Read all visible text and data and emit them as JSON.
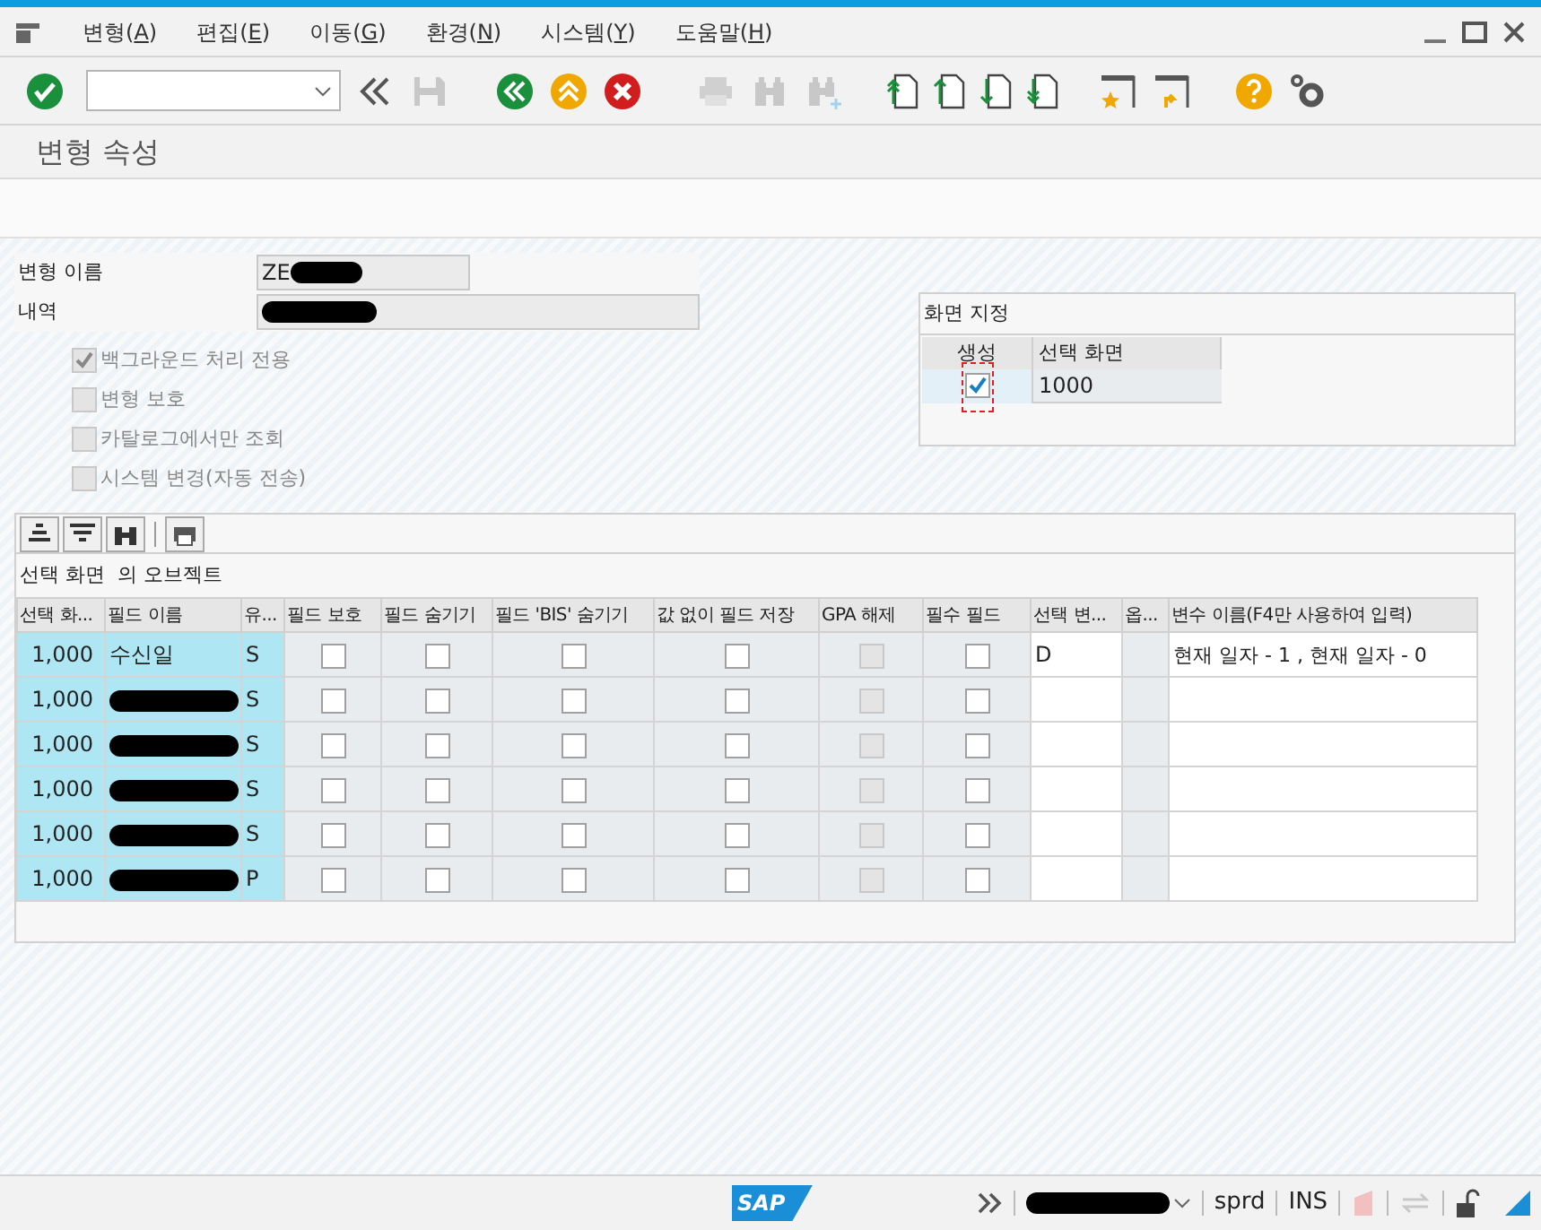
{
  "menu": [
    {
      "before": "변형(",
      "key": "A",
      "after": ")"
    },
    {
      "before": "편집(",
      "key": "E",
      "after": ")"
    },
    {
      "before": "이동(",
      "key": "G",
      "after": ")"
    },
    {
      "before": "환경(",
      "key": "N",
      "after": ")"
    },
    {
      "before": "시스템(",
      "key": "Y",
      "after": ")"
    },
    {
      "before": "도움말(",
      "key": "H",
      "after": ")"
    }
  ],
  "title": "변형 속성",
  "form": {
    "fields": [
      {
        "label": "변형 이름",
        "value": "ZE",
        "redacted": true
      },
      {
        "label": "내역",
        "redacted": true
      }
    ],
    "checkboxes": [
      {
        "label": "백그라운드 처리 전용",
        "checked": true,
        "disabled": true
      },
      {
        "label": "변형 보호",
        "checked": false,
        "disabled": true
      },
      {
        "label": "카탈로그에서만 조회",
        "checked": false,
        "disabled": true
      },
      {
        "label": "시스템 변경(자동 전송)",
        "checked": false,
        "disabled": true
      }
    ]
  },
  "screen_assignment": {
    "title": "화면 지정",
    "columns": [
      "생성",
      "선택 화면"
    ],
    "rows": [
      {
        "created": true,
        "screen": "1000"
      }
    ]
  },
  "grid": {
    "title": "선택 화면  의 오브젝트",
    "columns": [
      {
        "label": "선택 화...",
        "kind": "key"
      },
      {
        "label": "필드 이름",
        "kind": "key"
      },
      {
        "label": "유...",
        "kind": "key"
      },
      {
        "label": "필드 보호",
        "kind": "check"
      },
      {
        "label": "필드 숨기기",
        "kind": "check"
      },
      {
        "label": "필드 'BIS' 숨기기",
        "kind": "check"
      },
      {
        "label": "값 없이 필드 저장",
        "kind": "check"
      },
      {
        "label": "GPA 해제",
        "kind": "locked"
      },
      {
        "label": "필수 필드",
        "kind": "check"
      },
      {
        "label": "선택 변...",
        "kind": "text"
      },
      {
        "label": "옵...",
        "kind": "narrow"
      },
      {
        "label": "변수 이름(F4만 사용하여 입력)",
        "kind": "text"
      }
    ],
    "rows": [
      {
        "cells": [
          {
            "text": "1,000"
          },
          {
            "text": "수신일"
          },
          {
            "text": "S"
          },
          {
            "checked": false
          },
          {
            "checked": false
          },
          {
            "checked": false
          },
          {
            "checked": false
          },
          {
            "checked": false
          },
          {
            "checked": false
          },
          {
            "text": "D"
          },
          {},
          {
            "text": "현재 일자 -  1 , 현재 일자 -  0"
          }
        ]
      },
      {
        "cells": [
          {
            "text": "1,000"
          },
          {
            "redacted": true
          },
          {
            "text": "S"
          },
          {
            "checked": false
          },
          {
            "checked": false
          },
          {
            "checked": false
          },
          {
            "checked": false
          },
          {
            "checked": false
          },
          {
            "checked": false
          },
          {},
          {},
          {}
        ]
      },
      {
        "cells": [
          {
            "text": "1,000"
          },
          {
            "redacted": true
          },
          {
            "text": "S"
          },
          {
            "checked": false
          },
          {
            "checked": false
          },
          {
            "checked": false
          },
          {
            "checked": false
          },
          {
            "checked": false
          },
          {
            "checked": false
          },
          {},
          {},
          {}
        ]
      },
      {
        "cells": [
          {
            "text": "1,000"
          },
          {
            "redacted": true
          },
          {
            "text": "S"
          },
          {
            "checked": false
          },
          {
            "checked": false
          },
          {
            "checked": false
          },
          {
            "checked": false
          },
          {
            "checked": false
          },
          {
            "checked": false
          },
          {},
          {},
          {}
        ]
      },
      {
        "cells": [
          {
            "text": "1,000"
          },
          {
            "redacted": true
          },
          {
            "text": "S"
          },
          {
            "checked": false
          },
          {
            "checked": false
          },
          {
            "checked": false
          },
          {
            "checked": false
          },
          {
            "checked": false
          },
          {
            "checked": false
          },
          {},
          {},
          {}
        ]
      },
      {
        "cells": [
          {
            "text": "1,000"
          },
          {
            "redacted": true
          },
          {
            "text": "P"
          },
          {
            "checked": false
          },
          {
            "checked": false
          },
          {
            "checked": false
          },
          {
            "checked": false
          },
          {
            "checked": false
          },
          {
            "checked": false
          },
          {},
          {},
          {}
        ]
      }
    ]
  },
  "status_bar": {
    "logo": "SAP",
    "system_redacted": true,
    "client": "sprd",
    "mode": "INS"
  }
}
